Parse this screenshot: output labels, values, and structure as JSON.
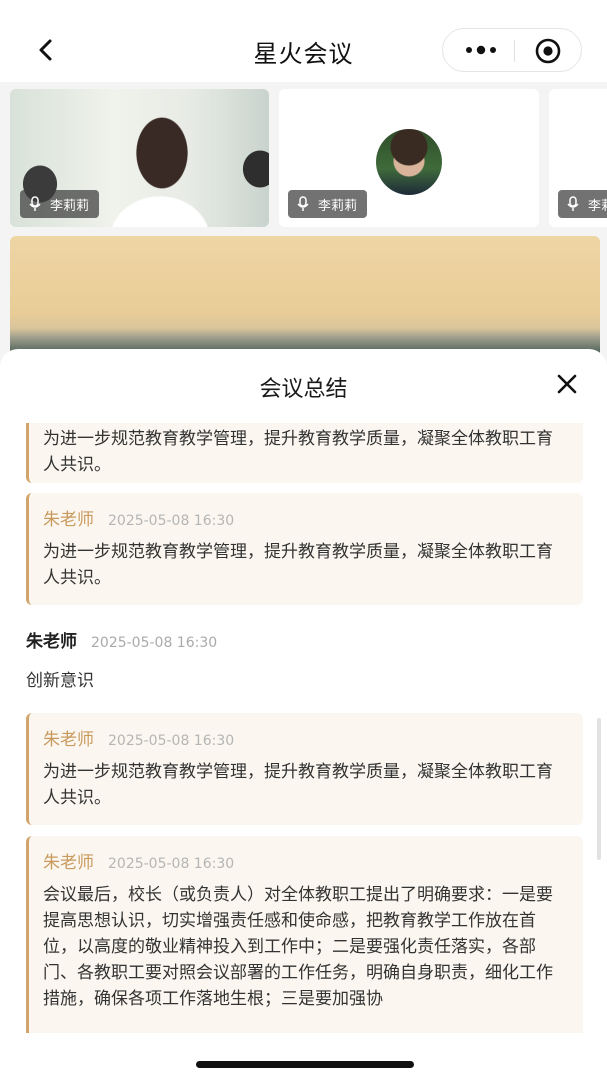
{
  "header": {
    "title": "星火会议"
  },
  "participants": [
    {
      "name": "李莉莉"
    },
    {
      "name": "李莉莉"
    },
    {
      "name": "李莉莉"
    }
  ],
  "summary": {
    "title": "会议总结",
    "messages": [
      {
        "author": "",
        "time": "",
        "text": "为进一步规范教育教学管理，提升教育教学质量，凝聚全体教职工育人共识。"
      },
      {
        "author": "朱老师",
        "time": "2025-05-08 16:30",
        "text": "为进一步规范教育教学管理，提升教育教学质量，凝聚全体教职工育人共识。"
      },
      {
        "author": "朱老师",
        "time": "2025-05-08 16:30",
        "text": "创新意识"
      },
      {
        "author": "朱老师",
        "time": "2025-05-08 16:30",
        "text": "为进一步规范教育教学管理，提升教育教学质量，凝聚全体教职工育人共识。"
      },
      {
        "author": "朱老师",
        "time": "2025-05-08 16:30",
        "text": "会议最后，校长（或负责人）对全体教职工提出了明确要求：一是要提高思想认识，切实增强责任感和使命感，把教育教学工作放在首位，以高度的敬业精神投入到工作中；二是要强化责任落实，各部门、各教职工要对照会议部署的工作任务，明确自身职责，细化工作措施，确保各项工作落地生根；三是要加强协"
      }
    ]
  },
  "colors": {
    "accent": "#c9995c",
    "card_border": "#d1a46c",
    "card_bg": "#fbf7f0"
  }
}
